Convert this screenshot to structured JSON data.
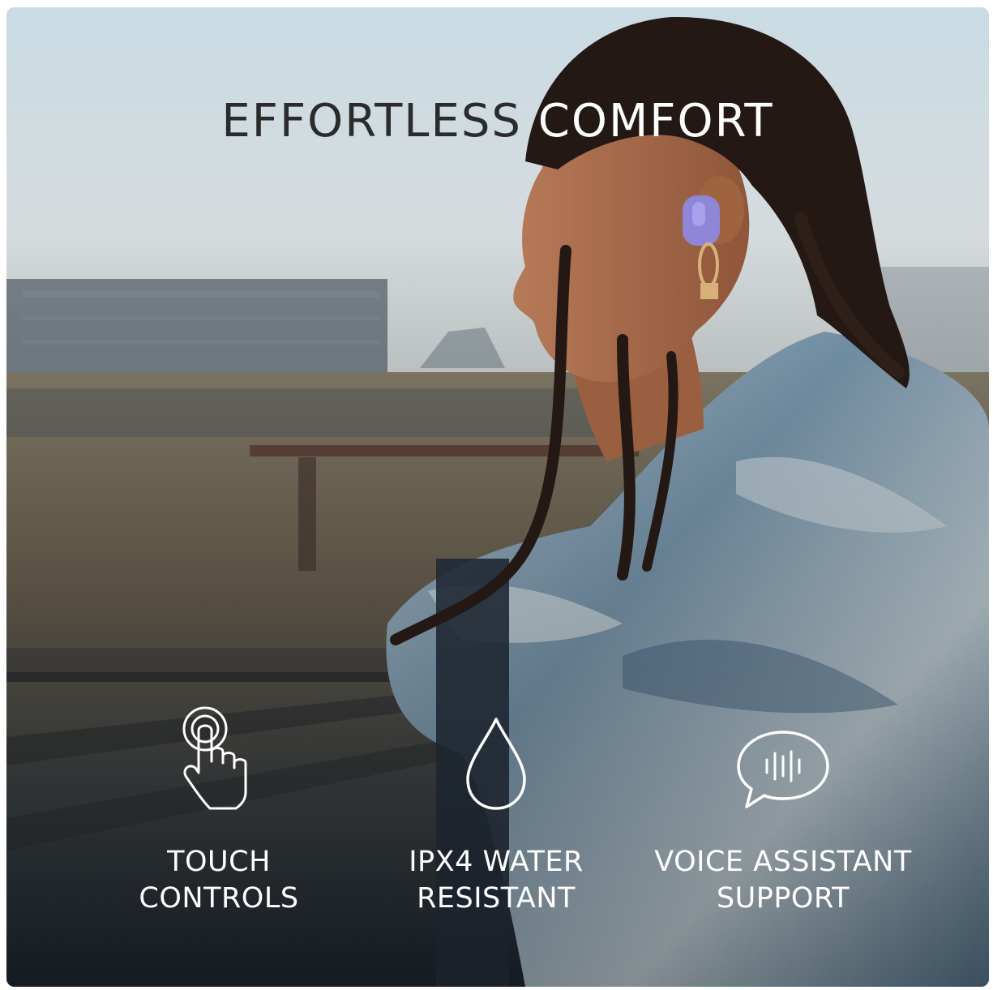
{
  "headline": {
    "word1": "EFFORTLESS",
    "word2": "COMFORT"
  },
  "features": [
    {
      "icon": "touch-tap-icon",
      "label": "TOUCH\nCONTROLS"
    },
    {
      "icon": "water-drop-icon",
      "label": "IPX4 WATER\nRESISTANT"
    },
    {
      "icon": "voice-bubble-icon",
      "label": "VOICE ASSISTANT\nSUPPORT"
    }
  ],
  "colors": {
    "headline_dark": "#2b2b2b",
    "headline_light": "#ffffff",
    "earbud": "#8f86d8"
  }
}
